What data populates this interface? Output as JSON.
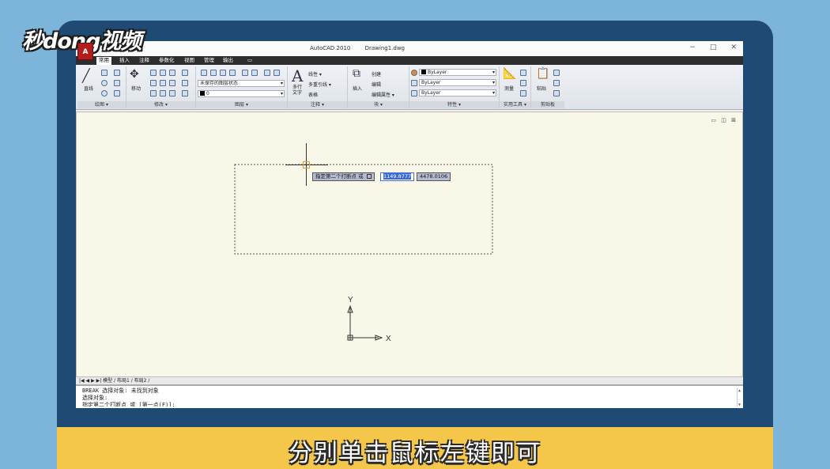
{
  "logo": "秒dong视频",
  "window": {
    "app_name": "AutoCAD 2010",
    "file_name": "Drawing1.dwg",
    "minimize": "−",
    "maximize": "□",
    "close": "✕",
    "app_button": "A"
  },
  "menu": [
    {
      "label": "常用",
      "active": true
    },
    {
      "label": "插入"
    },
    {
      "label": "注释"
    },
    {
      "label": "参数化"
    },
    {
      "label": "视图"
    },
    {
      "label": "管理"
    },
    {
      "label": "输出"
    },
    {
      "label": "▭"
    }
  ],
  "ribbon": {
    "draw": {
      "label": "绘图 ▾",
      "line": "直线"
    },
    "modify": {
      "label": "修改 ▾",
      "move": "移动"
    },
    "layers": {
      "label": "图层 ▾",
      "state_combo": "未保存的图层状态",
      "layer_combo": "0"
    },
    "annotation": {
      "label": "注释 ▾",
      "mtext": "多行\n文字",
      "linear": "线性 ▾",
      "mleader": "多重引线 ▾",
      "table": "表格"
    },
    "block": {
      "label": "块 ▾",
      "insert": "插入",
      "create": "创建",
      "edit": "编辑",
      "edit_attr": "编辑属性 ▾"
    },
    "properties": {
      "label": "特性 ▾",
      "color": "ByLayer",
      "linetype": "ByLayer",
      "lineweight": "ByLayer"
    },
    "utilities": {
      "label": "实用工具 ▾",
      "measure": "测量"
    },
    "clipboard": {
      "label": "剪贴板",
      "paste": "粘贴"
    }
  },
  "drawing": {
    "prompt": "指定第二个打断点 或",
    "value_x": "1149.8777",
    "value_y": "4478.0106",
    "axis_x": "X",
    "axis_y": "Y",
    "viewport_controls": "▭ ◫ ⊠"
  },
  "layout_tabs": "|◀ ◀ ▶ ▶|  模型  ∕ 布局1 ∕ 布局2 ∕",
  "command_line": {
    "line1": "BREAK 选择对象: 未找到对象",
    "line2": "选择对象:",
    "line3": "指定第二个打断点 或 [第一点(F)]:"
  },
  "caption": "分别单击鼠标左键即可",
  "colors": {
    "background": "#7cb4da",
    "monitor": "#1f4a74",
    "canvas": "#f8f7e8",
    "caption_bar": "#f4c64a",
    "highlight": "#3a6bd4"
  }
}
